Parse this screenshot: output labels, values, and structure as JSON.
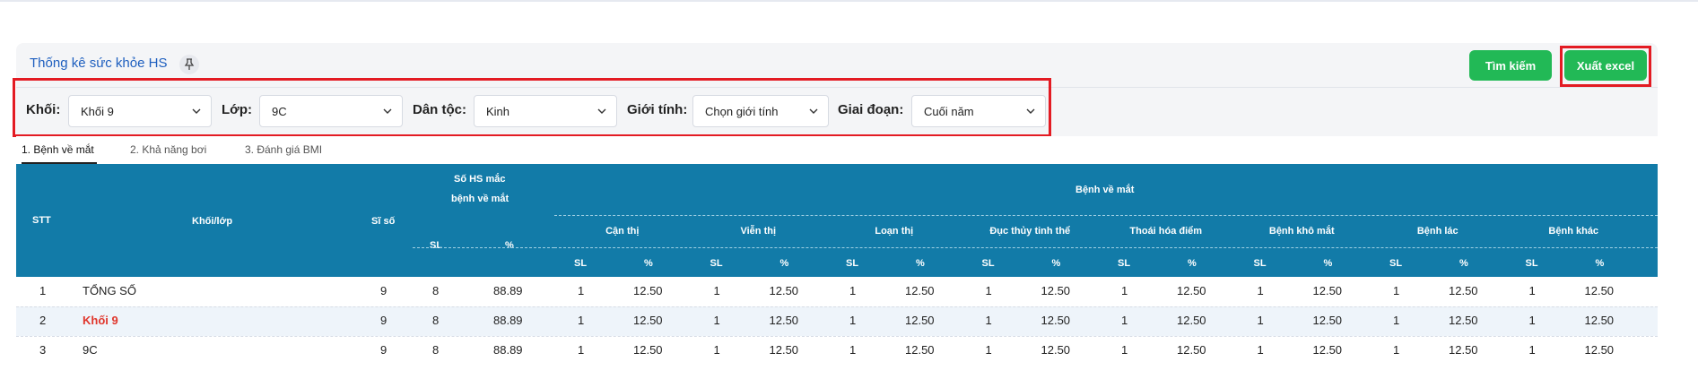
{
  "header": {
    "title": "Thống kê sức khỏe HS",
    "pin_icon": "pin-icon",
    "search_button": "Tìm kiếm",
    "export_button": "Xuất excel",
    "accent_color": "#22b956",
    "highlight_color": "#e31b23"
  },
  "filters": {
    "khoi": {
      "label": "Khối:",
      "value": "Khối 9"
    },
    "lop": {
      "label": "Lớp:",
      "value": "9C"
    },
    "dan_toc": {
      "label": "Dân tộc:",
      "value": "Kinh"
    },
    "gioi_tinh": {
      "label": "Giới tính:",
      "value": "Chọn giới tính"
    },
    "giai_doan": {
      "label": "Giai đoạn:",
      "value": "Cuối năm"
    }
  },
  "tabs": [
    "1. Bệnh về mắt",
    "2. Khả năng bơi",
    "3. Đánh giá BMI"
  ],
  "table": {
    "header_color": "#127ba8",
    "headers": {
      "stt": "STT",
      "khoi_lop": "Khối/lớp",
      "si_so": "Sĩ số",
      "so_hs_line1": "Số HS mắc",
      "so_hs_line2": "bệnh về mắt",
      "benh_ve_mat": "Bệnh về mắt",
      "sl": "SL",
      "pct": "%",
      "diseases": [
        "Cận thị",
        "Viễn thị",
        "Loạn thị",
        "Đục thủy tinh thể",
        "Thoái hóa điểm",
        "Bệnh khô mắt",
        "Bệnh lác",
        "Bệnh khác"
      ]
    },
    "rows": [
      {
        "stt": "1",
        "name": "TỔNG SỐ",
        "si_so": "9",
        "sl": "8",
        "pct": "88.89",
        "cells": [
          [
            "1",
            "12.50"
          ],
          [
            "1",
            "12.50"
          ],
          [
            "1",
            "12.50"
          ],
          [
            "1",
            "12.50"
          ],
          [
            "1",
            "12.50"
          ],
          [
            "1",
            "12.50"
          ],
          [
            "1",
            "12.50"
          ],
          [
            "1",
            "12.50"
          ]
        ]
      },
      {
        "stt": "2",
        "name": "Khối 9",
        "si_so": "9",
        "sl": "8",
        "pct": "88.89",
        "cells": [
          [
            "1",
            "12.50"
          ],
          [
            "1",
            "12.50"
          ],
          [
            "1",
            "12.50"
          ],
          [
            "1",
            "12.50"
          ],
          [
            "1",
            "12.50"
          ],
          [
            "1",
            "12.50"
          ],
          [
            "1",
            "12.50"
          ],
          [
            "1",
            "12.50"
          ]
        ]
      },
      {
        "stt": "3",
        "name": "9C",
        "si_so": "9",
        "sl": "8",
        "pct": "88.89",
        "cells": [
          [
            "1",
            "12.50"
          ],
          [
            "1",
            "12.50"
          ],
          [
            "1",
            "12.50"
          ],
          [
            "1",
            "12.50"
          ],
          [
            "1",
            "12.50"
          ],
          [
            "1",
            "12.50"
          ],
          [
            "1",
            "12.50"
          ],
          [
            "1",
            "12.50"
          ]
        ]
      }
    ]
  }
}
